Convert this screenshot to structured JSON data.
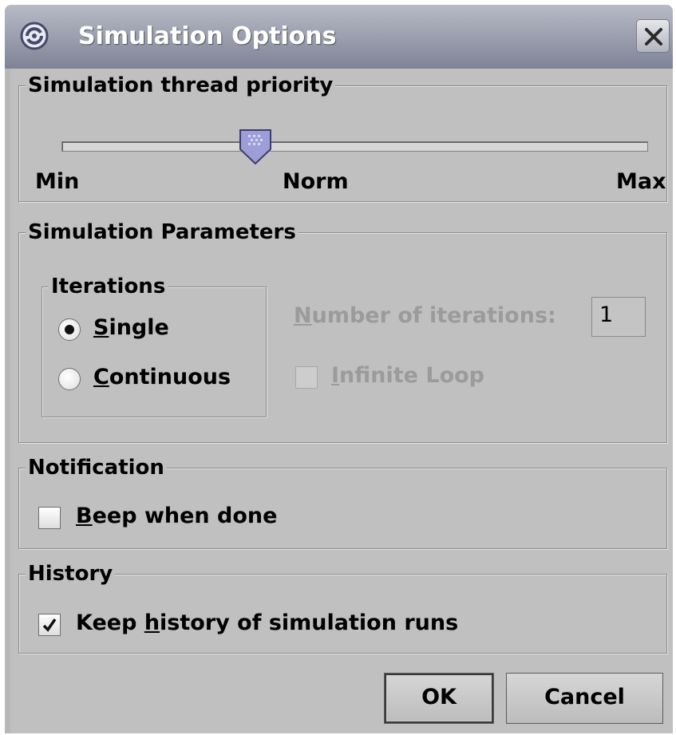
{
  "window": {
    "title": "Simulation Options",
    "icon": "app-swirl-icon",
    "close_icon": "close-icon"
  },
  "priority": {
    "title": "Simulation thread priority",
    "slider_value_fraction": 0.33,
    "min_label": "Min",
    "norm_label": "Norm",
    "max_label": "Max",
    "thumb_color": "#9d9ed8"
  },
  "parameters": {
    "title": "Simulation Parameters",
    "iterations": {
      "title": "Iterations",
      "single": {
        "mnemonic": "S",
        "rest": "ingle",
        "selected": true
      },
      "continuous": {
        "mnemonic": "C",
        "rest": "ontinuous",
        "selected": false
      }
    },
    "number_label": {
      "mnemonic": "N",
      "rest": "umber of iterations:"
    },
    "number_value": "1",
    "infinite_loop": {
      "mnemonic": "I",
      "rest": "nfinite Loop",
      "checked": false,
      "enabled": false
    }
  },
  "notification": {
    "title": "Notification",
    "beep": {
      "mnemonic": "B",
      "rest": "eep when done",
      "checked": false
    }
  },
  "history": {
    "title": "History",
    "keep": {
      "before": "Keep ",
      "mnemonic": "h",
      "rest": "istory of simulation runs",
      "checked": true
    }
  },
  "buttons": {
    "ok": "OK",
    "cancel": "Cancel"
  },
  "colors": {
    "dialog_bg": "#c0c0c0",
    "titlebar_top": "#b8bbc6",
    "titlebar_bottom": "#7e8396",
    "disabled_text": "#9b9b9b"
  }
}
